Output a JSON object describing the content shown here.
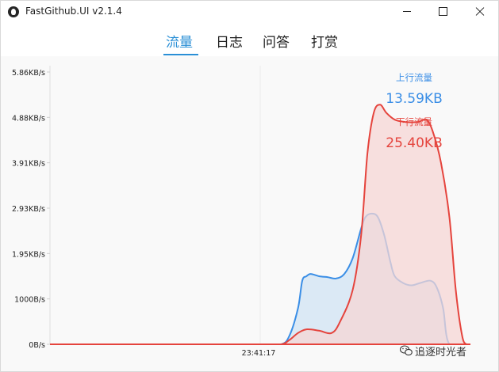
{
  "window": {
    "title": "FastGithub.UI v2.1.4"
  },
  "tabs": [
    {
      "label": "流量",
      "active": true
    },
    {
      "label": "日志",
      "active": false
    },
    {
      "label": "问答",
      "active": false
    },
    {
      "label": "打赏",
      "active": false
    }
  ],
  "icons": {
    "app": "github-cat-icon",
    "minimize": "minimize-icon",
    "maximize": "maximize-icon",
    "close": "close-icon",
    "watermark": "wechat-icon"
  },
  "watermark": {
    "text": "追逐时光者"
  },
  "colors": {
    "accent": "#2a8fd6",
    "upload": "#3a8ee6",
    "upload_fill": "#d6e6f5",
    "download": "#e5443d",
    "download_fill": "#f6d5d4",
    "text": "#1d1d1d"
  },
  "chart_data": {
    "type": "area",
    "ylabel": "",
    "xlabel": "",
    "y_ticks": [
      "0B/s",
      "1000B/s",
      "1.95KB/s",
      "2.93KB/s",
      "3.91KB/s",
      "4.88KB/s",
      "5.86KB/s"
    ],
    "y_tick_values": [
      0,
      1000,
      2000,
      3000,
      4000,
      5000,
      6000
    ],
    "ylim": [
      0,
      6000
    ],
    "x_ticks": [
      "23:41:17"
    ],
    "x_tick_times": [
      0.5
    ],
    "xlim": [
      0,
      1
    ],
    "grid": "vertical-only-at-x-tick",
    "series": [
      {
        "name": "上行流量",
        "total": "13.59KB",
        "color": "upload",
        "points": [
          [
            0.0,
            0
          ],
          [
            0.45,
            0
          ],
          [
            0.5,
            0
          ],
          [
            0.55,
            0
          ],
          [
            0.57,
            200
          ],
          [
            0.59,
            800
          ],
          [
            0.6,
            1400
          ],
          [
            0.61,
            1500
          ],
          [
            0.62,
            1550
          ],
          [
            0.64,
            1500
          ],
          [
            0.66,
            1480
          ],
          [
            0.68,
            1450
          ],
          [
            0.7,
            1550
          ],
          [
            0.72,
            1900
          ],
          [
            0.74,
            2550
          ],
          [
            0.75,
            2800
          ],
          [
            0.765,
            2880
          ],
          [
            0.78,
            2800
          ],
          [
            0.795,
            2400
          ],
          [
            0.81,
            1800
          ],
          [
            0.82,
            1500
          ],
          [
            0.84,
            1350
          ],
          [
            0.86,
            1300
          ],
          [
            0.88,
            1350
          ],
          [
            0.905,
            1400
          ],
          [
            0.92,
            1250
          ],
          [
            0.935,
            800
          ],
          [
            0.95,
            0
          ],
          [
            1.0,
            0
          ]
        ]
      },
      {
        "name": "下行流量",
        "total": "25.40KB",
        "color": "download",
        "points": [
          [
            0.0,
            0
          ],
          [
            0.5,
            0
          ],
          [
            0.55,
            0
          ],
          [
            0.57,
            100
          ],
          [
            0.59,
            250
          ],
          [
            0.61,
            330
          ],
          [
            0.64,
            300
          ],
          [
            0.67,
            250
          ],
          [
            0.69,
            500
          ],
          [
            0.72,
            1200
          ],
          [
            0.74,
            2400
          ],
          [
            0.755,
            4200
          ],
          [
            0.77,
            5100
          ],
          [
            0.785,
            5280
          ],
          [
            0.8,
            5100
          ],
          [
            0.82,
            4950
          ],
          [
            0.845,
            4900
          ],
          [
            0.875,
            4900
          ],
          [
            0.895,
            4950
          ],
          [
            0.91,
            4700
          ],
          [
            0.93,
            4000
          ],
          [
            0.95,
            2800
          ],
          [
            0.965,
            1200
          ],
          [
            0.98,
            200
          ],
          [
            0.99,
            0
          ],
          [
            1.0,
            0
          ]
        ]
      }
    ]
  }
}
